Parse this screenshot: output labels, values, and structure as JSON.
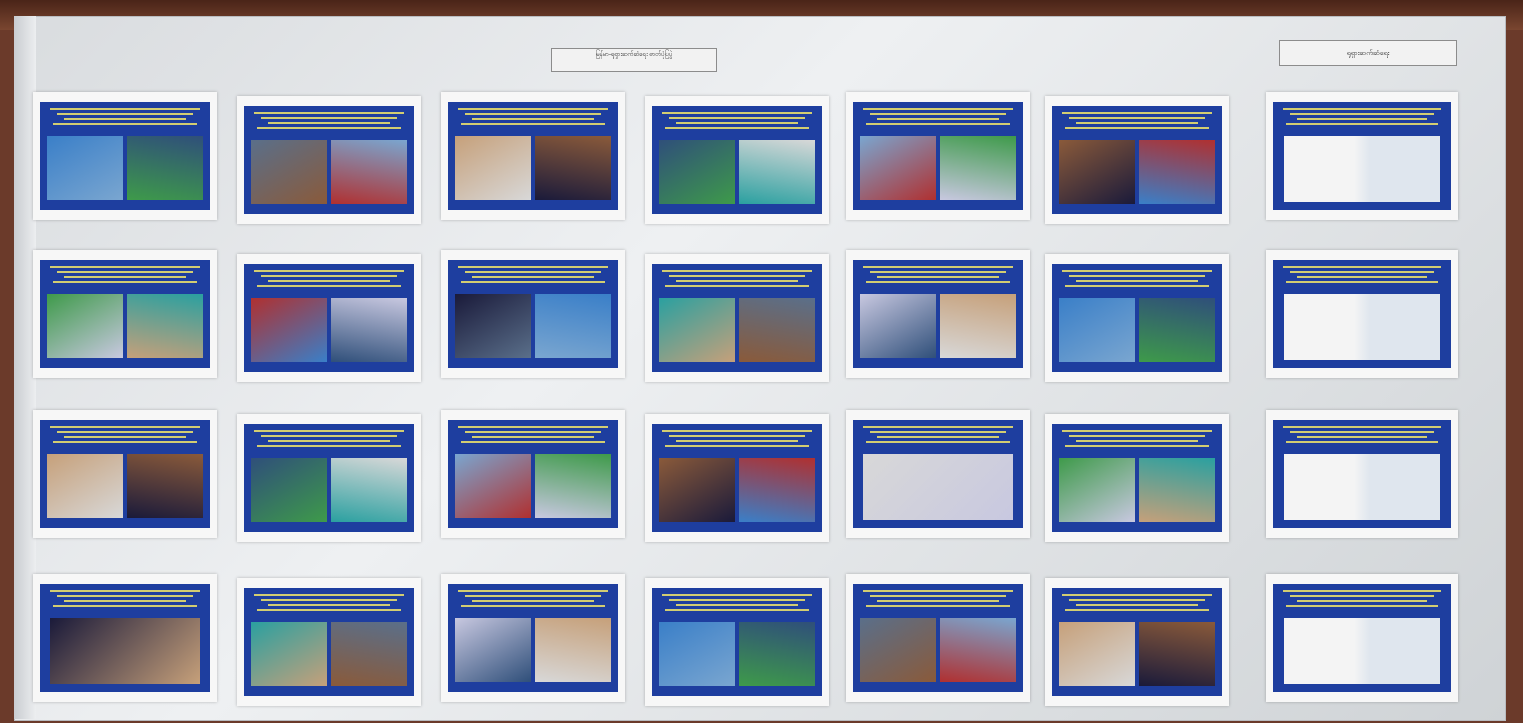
{
  "scene": {
    "description_colors": {
      "board": "#e6e8ea",
      "panel_blue": "#1e3e9f",
      "caption_yellow": "#f2e66a",
      "wood": "#6b3a2a"
    },
    "header_center_text": "မြန်မာ-ရုရှားဆက်ဆံရေး ဓာတ်ပုံပြပွဲ",
    "header_right_text": "ရုရှားဆက်ဆံရေး",
    "photo_tones": [
      "#3a7fc8",
      "#5a6f8a",
      "#c6a07a",
      "#2f4f7a",
      "#7aa6d0",
      "#8a5a3a",
      "#d8d8d8",
      "#3e9a4a",
      "#b03030",
      "#1a1a3a",
      "#2aa0a0",
      "#c8c8e0"
    ]
  }
}
